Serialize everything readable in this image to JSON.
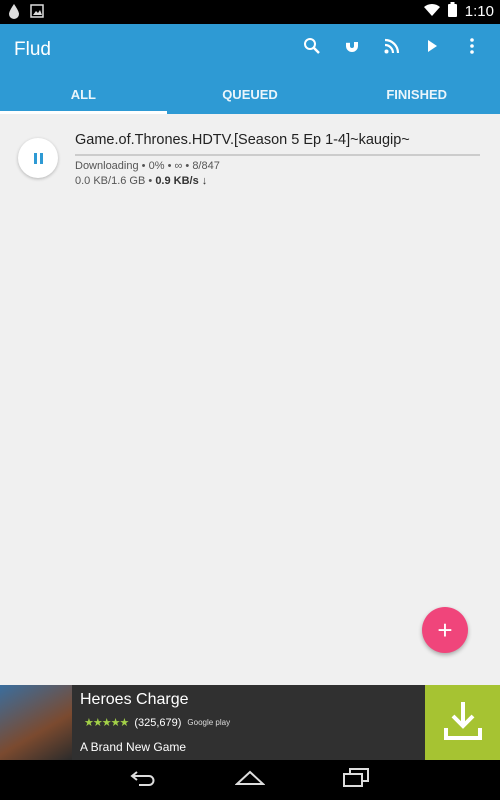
{
  "status_bar": {
    "time": "1:10"
  },
  "app": {
    "title": "Flud"
  },
  "toolbar": {
    "actions": [
      {
        "icon": "search-icon"
      },
      {
        "icon": "magnet-icon"
      },
      {
        "icon": "rss-icon"
      },
      {
        "icon": "play-icon"
      },
      {
        "icon": "overflow-menu-icon"
      }
    ]
  },
  "tabs": [
    {
      "label": "ALL",
      "active": true
    },
    {
      "label": "QUEUED",
      "active": false
    },
    {
      "label": "FINISHED",
      "active": false
    }
  ],
  "torrent": {
    "name": "Game.of.Thrones.HDTV.[Season 5 Ep 1-4]~kaugip~",
    "status": "Downloading",
    "percent": "0%",
    "eta": "∞",
    "pieces": "8/847",
    "size": "0.0 KB/1.6 GB",
    "speed": "0.9 KB/s",
    "speed_arrow": "↓",
    "progress_fraction": 0
  },
  "fab": {
    "label": "+"
  },
  "ad": {
    "title": "Heroes Charge",
    "stars": "★★★★★",
    "reviews": "(325,679)",
    "store": "Google play",
    "subtitle": "A Brand New Game"
  },
  "colors": {
    "primary": "#2e9ad4",
    "fab": "#f0457b",
    "ad_download": "#a6c332"
  }
}
